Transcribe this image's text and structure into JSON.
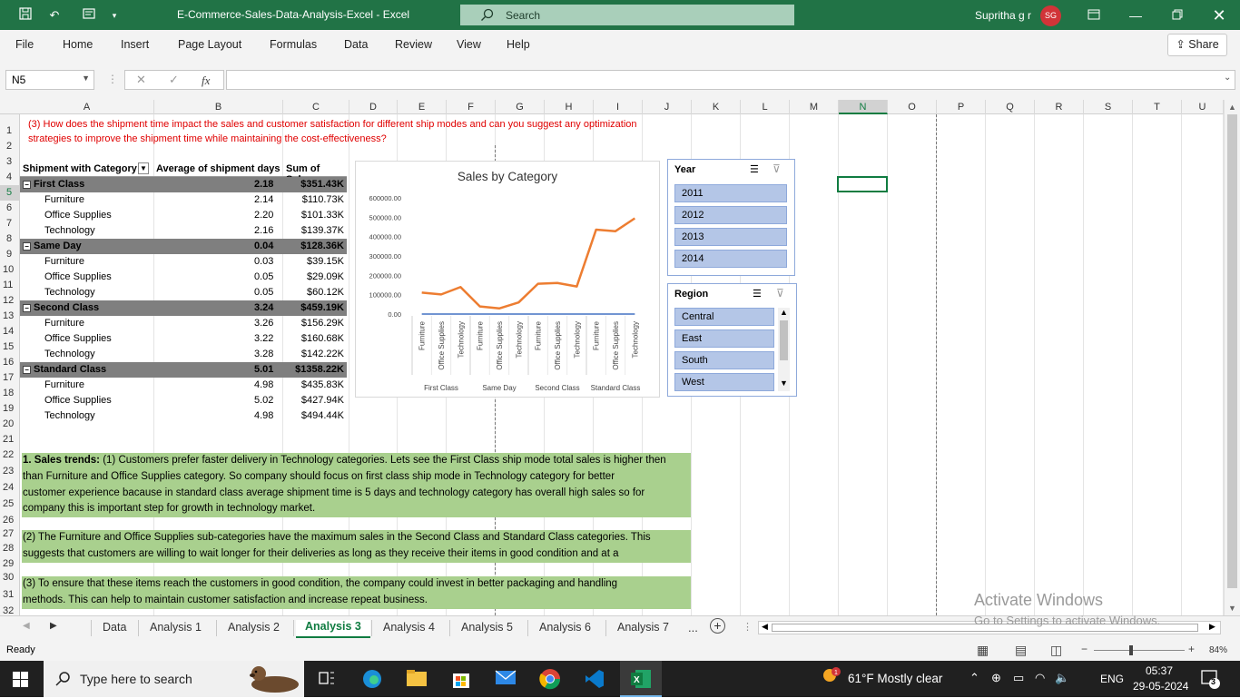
{
  "window": {
    "title": "E-Commerce-Sales-Data-Analysis-Excel  -  Excel",
    "search_placeholder": "Search",
    "user": "Supritha g r",
    "initials": "SG"
  },
  "ribbon": {
    "tabs": [
      "File",
      "Home",
      "Insert",
      "Page Layout",
      "Formulas",
      "Data",
      "Review",
      "View",
      "Help"
    ],
    "share": "Share"
  },
  "formula_bar": {
    "name_box": "N5",
    "fx": "fx",
    "value": ""
  },
  "columns": [
    "A",
    "B",
    "C",
    "D",
    "E",
    "F",
    "G",
    "H",
    "I",
    "J",
    "K",
    "L",
    "M",
    "N",
    "O",
    "P",
    "Q",
    "R",
    "S",
    "T",
    "U"
  ],
  "selected_column": "N",
  "rows": [
    1,
    2,
    3,
    4,
    5,
    6,
    7,
    8,
    9,
    10,
    11,
    12,
    13,
    14,
    15,
    16,
    17,
    18,
    19,
    20,
    21,
    22,
    23,
    24,
    25,
    26,
    27,
    28,
    29,
    30,
    31,
    32
  ],
  "question": {
    "line1": "(3) How does the shipment time impact the sales and customer satisfaction for different ship modes and can you suggest any optimization",
    "line2": "strategies to improve the shipment time while maintaining the cost-effectiveness?"
  },
  "pivot": {
    "headers": [
      "Shipment with Category",
      "Average of shipment days",
      "Sum of Sales"
    ],
    "rows": [
      {
        "label": "First Class",
        "days": "2.18",
        "sales": "$351.43K",
        "group": true
      },
      {
        "label": "Furniture",
        "days": "2.14",
        "sales": "$110.73K",
        "group": false
      },
      {
        "label": "Office Supplies",
        "days": "2.20",
        "sales": "$101.33K",
        "group": false
      },
      {
        "label": "Technology",
        "days": "2.16",
        "sales": "$139.37K",
        "group": false
      },
      {
        "label": "Same Day",
        "days": "0.04",
        "sales": "$128.36K",
        "group": true
      },
      {
        "label": "Furniture",
        "days": "0.03",
        "sales": "$39.15K",
        "group": false
      },
      {
        "label": "Office Supplies",
        "days": "0.05",
        "sales": "$29.09K",
        "group": false
      },
      {
        "label": "Technology",
        "days": "0.05",
        "sales": "$60.12K",
        "group": false
      },
      {
        "label": "Second Class",
        "days": "3.24",
        "sales": "$459.19K",
        "group": true
      },
      {
        "label": "Furniture",
        "days": "3.26",
        "sales": "$156.29K",
        "group": false
      },
      {
        "label": "Office Supplies",
        "days": "3.22",
        "sales": "$160.68K",
        "group": false
      },
      {
        "label": "Technology",
        "days": "3.28",
        "sales": "$142.22K",
        "group": false
      },
      {
        "label": "Standard Class",
        "days": "5.01",
        "sales": "$1358.22K",
        "group": true
      },
      {
        "label": "Furniture",
        "days": "4.98",
        "sales": "$435.83K",
        "group": false
      },
      {
        "label": "Office Supplies",
        "days": "5.02",
        "sales": "$427.94K",
        "group": false
      },
      {
        "label": "Technology",
        "days": "4.98",
        "sales": "$494.44K",
        "group": false
      }
    ]
  },
  "chart_data": {
    "type": "line",
    "title": "Sales by Category",
    "categories": [
      "Furniture",
      "Office Supplies",
      "Technology",
      "Furniture",
      "Office Supplies",
      "Technology",
      "Furniture",
      "Office Supplies",
      "Technology",
      "Furniture",
      "Office Supplies",
      "Technology"
    ],
    "groups": [
      "First Class",
      "Same Day",
      "Second Class",
      "Standard Class"
    ],
    "series": [
      {
        "name": "Sum of Sales",
        "values": [
          110730,
          101330,
          139370,
          39150,
          29090,
          60120,
          156290,
          160680,
          142220,
          435830,
          427940,
          494440
        ],
        "color": "#ed7d31"
      },
      {
        "name": "Average of shipment days",
        "values": [
          2.14,
          2.2,
          2.16,
          0.03,
          0.05,
          0.05,
          3.26,
          3.22,
          3.28,
          4.98,
          5.02,
          4.98
        ],
        "color": "#4472c4"
      }
    ],
    "yticks": [
      "0.00",
      "100000.00",
      "200000.00",
      "300000.00",
      "400000.00",
      "500000.00",
      "600000.00"
    ],
    "ylim": [
      0,
      600000
    ]
  },
  "slicers": {
    "year": {
      "title": "Year",
      "items": [
        "2011",
        "2012",
        "2013",
        "2014"
      ]
    },
    "region": {
      "title": "Region",
      "items": [
        "Central",
        "East",
        "South",
        "West"
      ]
    }
  },
  "notes": {
    "n1_bold": "1. Sales trends:",
    "n1_l1": " (1) Customers prefer faster delivery in Technology categories. Lets see the First Class ship mode total sales is higher then",
    "n1_l2": "than Furniture and Office Supplies category. So company should focus on first class ship mode in Technology category for better",
    "n1_l3": "customer experience bacause in standard class average shipment time is 5 days and technology category has overall high sales so for",
    "n1_l4": "company this is important step for growth in technology market.",
    "n2_l1": "(2) The Furniture and Office Supplies sub-categories have the maximum sales in the Second Class and Standard Class categories. This",
    "n2_l2": "suggests that customers are willing to wait longer for their deliveries as long as they receive their items in good condition and at a",
    "n3_l1": "(3)  To ensure that these items reach the customers in good condition, the company could invest in better packaging and handling",
    "n3_l2": "methods. This can help to maintain customer satisfaction and increase repeat business."
  },
  "sheets": {
    "tabs": [
      "Data",
      "Analysis 1",
      "Analysis 2",
      "Analysis 3",
      "Analysis 4",
      "Analysis 5",
      "Analysis 6",
      "Analysis 7"
    ],
    "active": "Analysis 3",
    "more": "..."
  },
  "status": {
    "ready": "Ready",
    "zoom": "84%"
  },
  "watermark": {
    "line1": "Activate Windows",
    "line2": "Go to Settings to activate Windows."
  },
  "taskbar": {
    "search": "Type here to search",
    "weather": "61°F  Mostly clear",
    "lang": "ENG",
    "time": "05:37",
    "date": "29-05-2024",
    "notif": "3"
  }
}
